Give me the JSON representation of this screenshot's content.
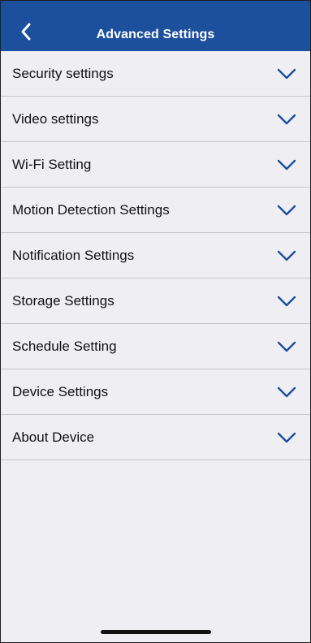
{
  "header": {
    "title": "Advanced Settings",
    "back_icon": "chevron-left-icon",
    "background_color": "#1c4f9c"
  },
  "settings": {
    "items": [
      {
        "label": "Security settings",
        "icon": "chevron-down-icon"
      },
      {
        "label": "Video settings",
        "icon": "chevron-down-icon"
      },
      {
        "label": "Wi-Fi Setting",
        "icon": "chevron-down-icon"
      },
      {
        "label": "Motion Detection Settings",
        "icon": "chevron-down-icon"
      },
      {
        "label": "Notification Settings",
        "icon": "chevron-down-icon"
      },
      {
        "label": "Storage Settings",
        "icon": "chevron-down-icon"
      },
      {
        "label": "Schedule Setting",
        "icon": "chevron-down-icon"
      },
      {
        "label": "Device Settings",
        "icon": "chevron-down-icon"
      },
      {
        "label": "About Device",
        "icon": "chevron-down-icon"
      }
    ],
    "chevron_color": "#1c4f9c",
    "background_color": "#efeef3"
  }
}
